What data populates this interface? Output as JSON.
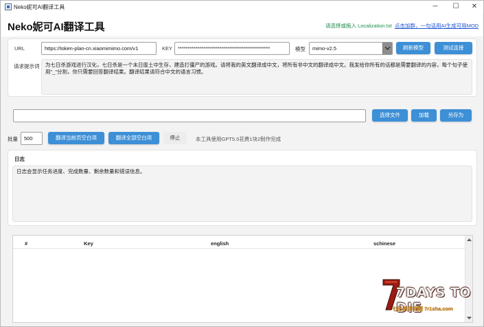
{
  "window": {
    "title": "Neko妮可AI翻译工具",
    "minimize_glyph": "─",
    "maximize_glyph": "☐",
    "close_glyph": "✕"
  },
  "header": {
    "app_title": "Neko妮可AI翻译工具",
    "hint": "请选择或拖入 Localization.txt",
    "join_link": "点击加群，一句话用AI生成可用MOD"
  },
  "config": {
    "url_label": "URL",
    "url_value": "https://token-plan-cn.xiaomimimo.com/v1",
    "key_label": "KEY",
    "key_value": "**********************************************",
    "model_label": "模型",
    "model_value": "mimo-v2.5",
    "refresh_model_button": "刷新模型",
    "test_connection_button": "测试连接",
    "prompt_label": "请求提示词",
    "prompt_text": "为七日杀游戏进行汉化，七日杀是一个末日废土中生存，建造打僵尸的游戏。请将我的英文翻译成中文，将所有非中文的翻译成中文。我发给你所有的话都是需要翻译的内容，每个句子使用\"_\"分割，你只需要回答翻译结果。翻译结果请符合中文的语言习惯。"
  },
  "file": {
    "path_value": "",
    "select_file_button": "选择文件",
    "load_button": "加载",
    "save_as_button": "另存为"
  },
  "batch": {
    "label": "批量",
    "value": "500",
    "translate_page_button": "翻译当前页空白项",
    "translate_all_button": "翻译全部空白项",
    "stop_button": "停止",
    "note": "本工具使用GPT5.5花费1块2制作完成"
  },
  "log": {
    "title": "日志",
    "text": "日志会显示任务进度、完成数量、剩余数量和错误信息。"
  },
  "table": {
    "columns": [
      "#",
      "Key",
      "english",
      "schinese"
    ]
  },
  "logo": {
    "main": "7DAYS TO DIE",
    "sub": "七日杀中文网 7r1sha.com"
  },
  "colors": {
    "accent": "#3d8fd6",
    "hint_green": "#1f8b4c",
    "link_blue": "#1f55d6"
  }
}
